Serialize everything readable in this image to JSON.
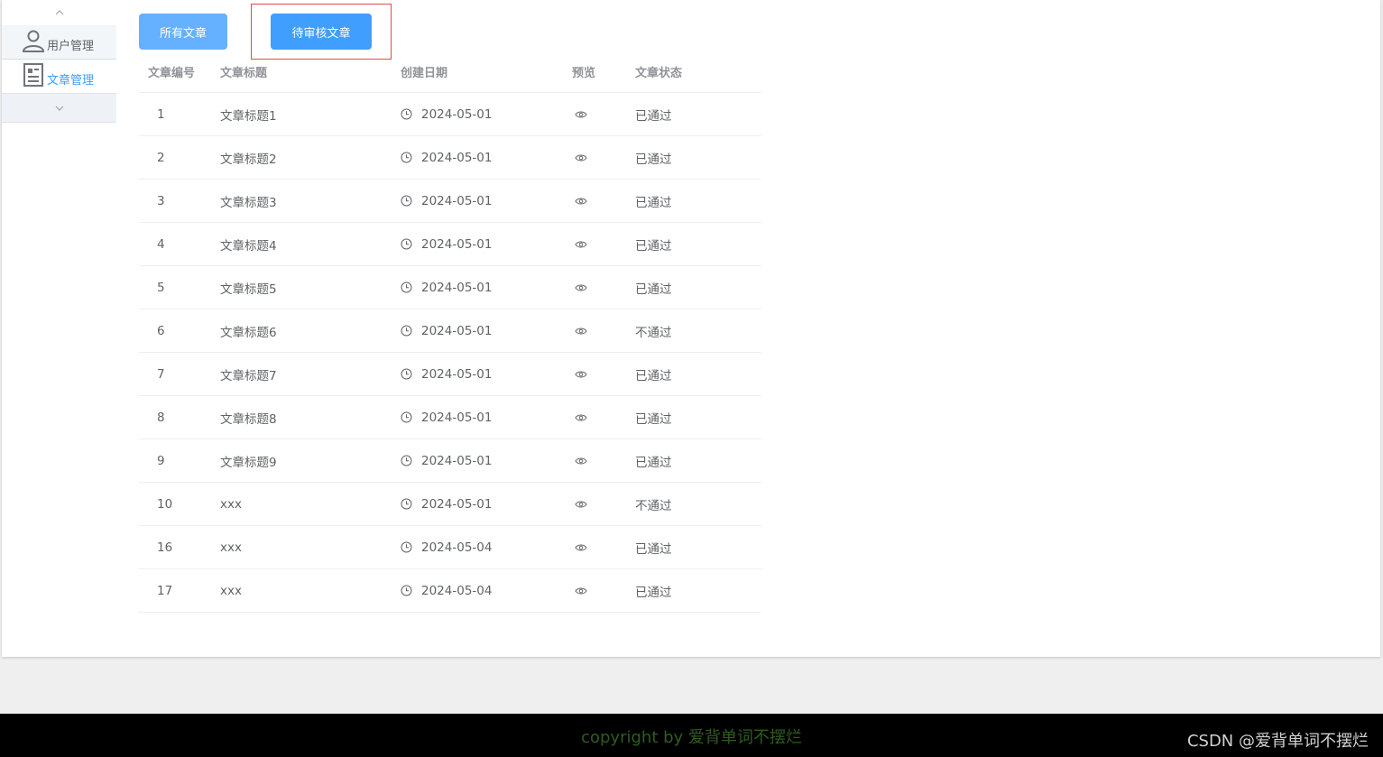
{
  "sidebar": {
    "items": [
      {
        "label": "用户管理",
        "icon": "user-icon"
      },
      {
        "label": "文章管理",
        "icon": "document-icon",
        "active": true
      }
    ]
  },
  "buttons": {
    "all_articles": "所有文章",
    "pending_articles": "待审核文章"
  },
  "table": {
    "columns": [
      "文章编号",
      "文章标题",
      "创建日期",
      "预览",
      "文章状态"
    ],
    "rows": [
      {
        "id": "1",
        "title": "文章标题1",
        "date": "2024-05-01",
        "status": "已通过"
      },
      {
        "id": "2",
        "title": "文章标题2",
        "date": "2024-05-01",
        "status": "已通过"
      },
      {
        "id": "3",
        "title": "文章标题3",
        "date": "2024-05-01",
        "status": "已通过"
      },
      {
        "id": "4",
        "title": "文章标题4",
        "date": "2024-05-01",
        "status": "已通过"
      },
      {
        "id": "5",
        "title": "文章标题5",
        "date": "2024-05-01",
        "status": "已通过"
      },
      {
        "id": "6",
        "title": "文章标题6",
        "date": "2024-05-01",
        "status": "不通过"
      },
      {
        "id": "7",
        "title": "文章标题7",
        "date": "2024-05-01",
        "status": "已通过"
      },
      {
        "id": "8",
        "title": "文章标题8",
        "date": "2024-05-01",
        "status": "已通过"
      },
      {
        "id": "9",
        "title": "文章标题9",
        "date": "2024-05-01",
        "status": "已通过"
      },
      {
        "id": "10",
        "title": "xxx",
        "date": "2024-05-01",
        "status": "不通过"
      },
      {
        "id": "16",
        "title": "xxx",
        "date": "2024-05-04",
        "status": "已通过"
      },
      {
        "id": "17",
        "title": "xxx",
        "date": "2024-05-04",
        "status": "已通过"
      }
    ]
  },
  "footer": {
    "copyright": "copyright by 爱背单词不摆烂",
    "watermark": "CSDN @爱背单词不摆烂"
  },
  "colors": {
    "primary": "#409eff",
    "primary_light": "#66b1ff",
    "highlight_border": "#e04a4a",
    "footer_bg": "#000000",
    "copyright_text": "#2f5c1f"
  }
}
